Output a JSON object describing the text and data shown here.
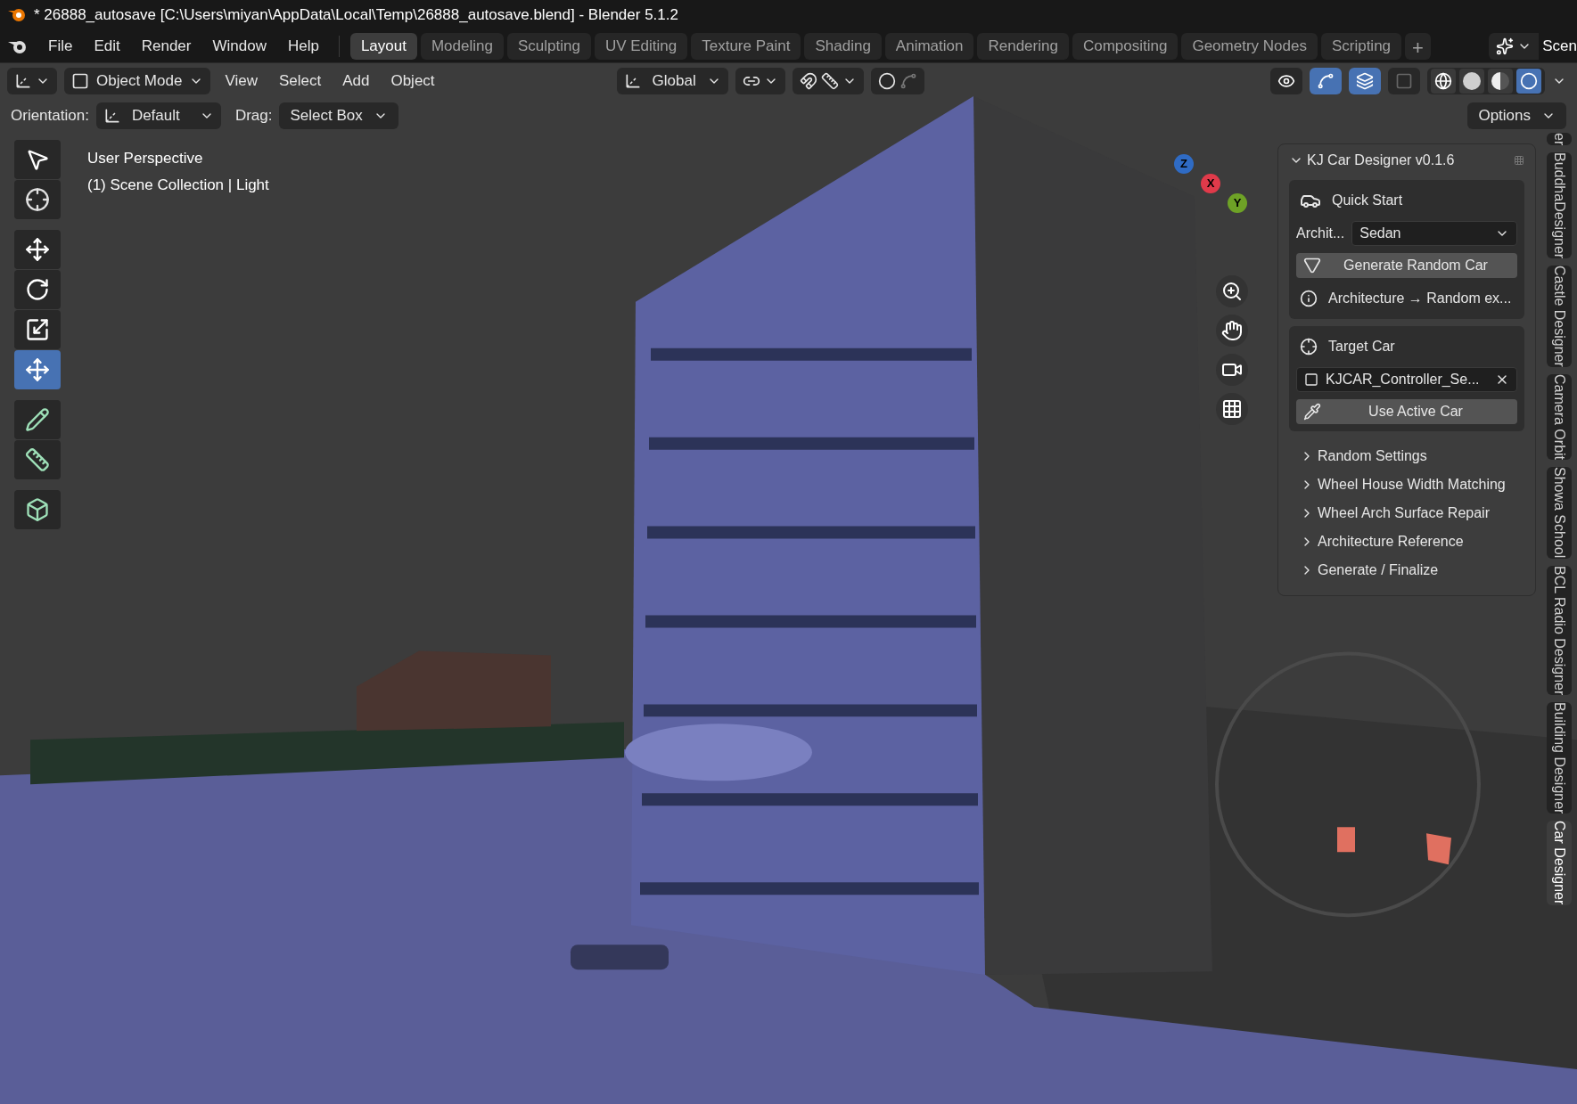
{
  "window": {
    "title": "* 26888_autosave [C:\\Users\\miyan\\AppData\\Local\\Temp\\26888_autosave.blend] - Blender 5.1.2"
  },
  "menu": [
    "File",
    "Edit",
    "Render",
    "Window",
    "Help"
  ],
  "workspaces": [
    {
      "label": "Layout",
      "selected": true
    },
    {
      "label": "Modeling",
      "selected": false
    },
    {
      "label": "Sculpting",
      "selected": false
    },
    {
      "label": "UV Editing",
      "selected": false
    },
    {
      "label": "Texture Paint",
      "selected": false
    },
    {
      "label": "Shading",
      "selected": false
    },
    {
      "label": "Animation",
      "selected": false
    },
    {
      "label": "Rendering",
      "selected": false
    },
    {
      "label": "Compositing",
      "selected": false
    },
    {
      "label": "Geometry Nodes",
      "selected": false
    },
    {
      "label": "Scripting",
      "selected": false
    }
  ],
  "add_workspace": "+",
  "scene": "Scen",
  "header": {
    "mode": "Object Mode",
    "menus": [
      "View",
      "Select",
      "Add",
      "Object"
    ],
    "transform_orientation": "Global"
  },
  "viewport_toggles": [
    {
      "kind": "visibility",
      "on": false
    },
    {
      "kind": "gizmo",
      "on": true
    },
    {
      "kind": "overlay",
      "on": true
    },
    {
      "kind": "xray",
      "on": false
    }
  ],
  "shading": [
    {
      "kind": "wireframe",
      "selected": false
    },
    {
      "kind": "solid",
      "selected": false
    },
    {
      "kind": "material",
      "selected": false
    },
    {
      "kind": "rendered",
      "selected": true
    }
  ],
  "tool_settings": {
    "orientation_label": "Orientation:",
    "orientation": "Default",
    "drag_label": "Drag:",
    "drag": "Select Box",
    "options": "Options"
  },
  "tool_groups": [
    {
      "tools": [
        {
          "kind": "select",
          "selected": false
        },
        {
          "kind": "cursor",
          "selected": false
        }
      ]
    },
    {
      "tools": [
        {
          "kind": "move",
          "selected": false
        },
        {
          "kind": "rotate",
          "selected": false
        },
        {
          "kind": "scale",
          "selected": false
        },
        {
          "kind": "transform",
          "selected": true
        }
      ]
    },
    {
      "tools": [
        {
          "kind": "annotate",
          "selected": false
        },
        {
          "kind": "measure",
          "selected": false
        }
      ]
    },
    {
      "tools": [
        {
          "kind": "add_cube",
          "selected": false
        }
      ]
    }
  ],
  "overlay_text": [
    "User Perspective",
    "(1) Scene Collection | Light"
  ],
  "gizmo_axes": [
    {
      "label": "Z",
      "color": "#2f6bc4"
    },
    {
      "label": "X",
      "color": "#e03a4a"
    },
    {
      "label": "Y",
      "color": "#6ea226"
    }
  ],
  "sidebar": {
    "title": "KJ Car Designer v0.1.6",
    "quick_start": {
      "heading": "Quick Start",
      "field_label": "Archit...",
      "field_value": "Sedan",
      "generate_button": "Generate Random Car",
      "info": "Architecture → Random ex..."
    },
    "target": {
      "heading": "Target Car",
      "object": "KJCAR_Controller_Se...",
      "button": "Use Active Car"
    },
    "subpanels": [
      {
        "label": "Random Settings",
        "expanded": false
      },
      {
        "label": "Wheel House Width Matching",
        "expanded": false
      },
      {
        "label": "Wheel Arch Surface Repair",
        "expanded": false
      },
      {
        "label": "Architecture Reference",
        "expanded": false
      },
      {
        "label": "Generate / Finalize",
        "expanded": false
      }
    ]
  },
  "side_tabs": [
    {
      "label": "er",
      "selected": false
    },
    {
      "label": "BuddhaDesigner",
      "selected": false
    },
    {
      "label": "Castle Designer",
      "selected": false
    },
    {
      "label": "Camera Orbit",
      "selected": false
    },
    {
      "label": "Showa School",
      "selected": false
    },
    {
      "label": "BCL Radio Designer",
      "selected": false
    },
    {
      "label": "Building Designer",
      "selected": false
    },
    {
      "label": "Car Designer",
      "selected": true
    }
  ]
}
